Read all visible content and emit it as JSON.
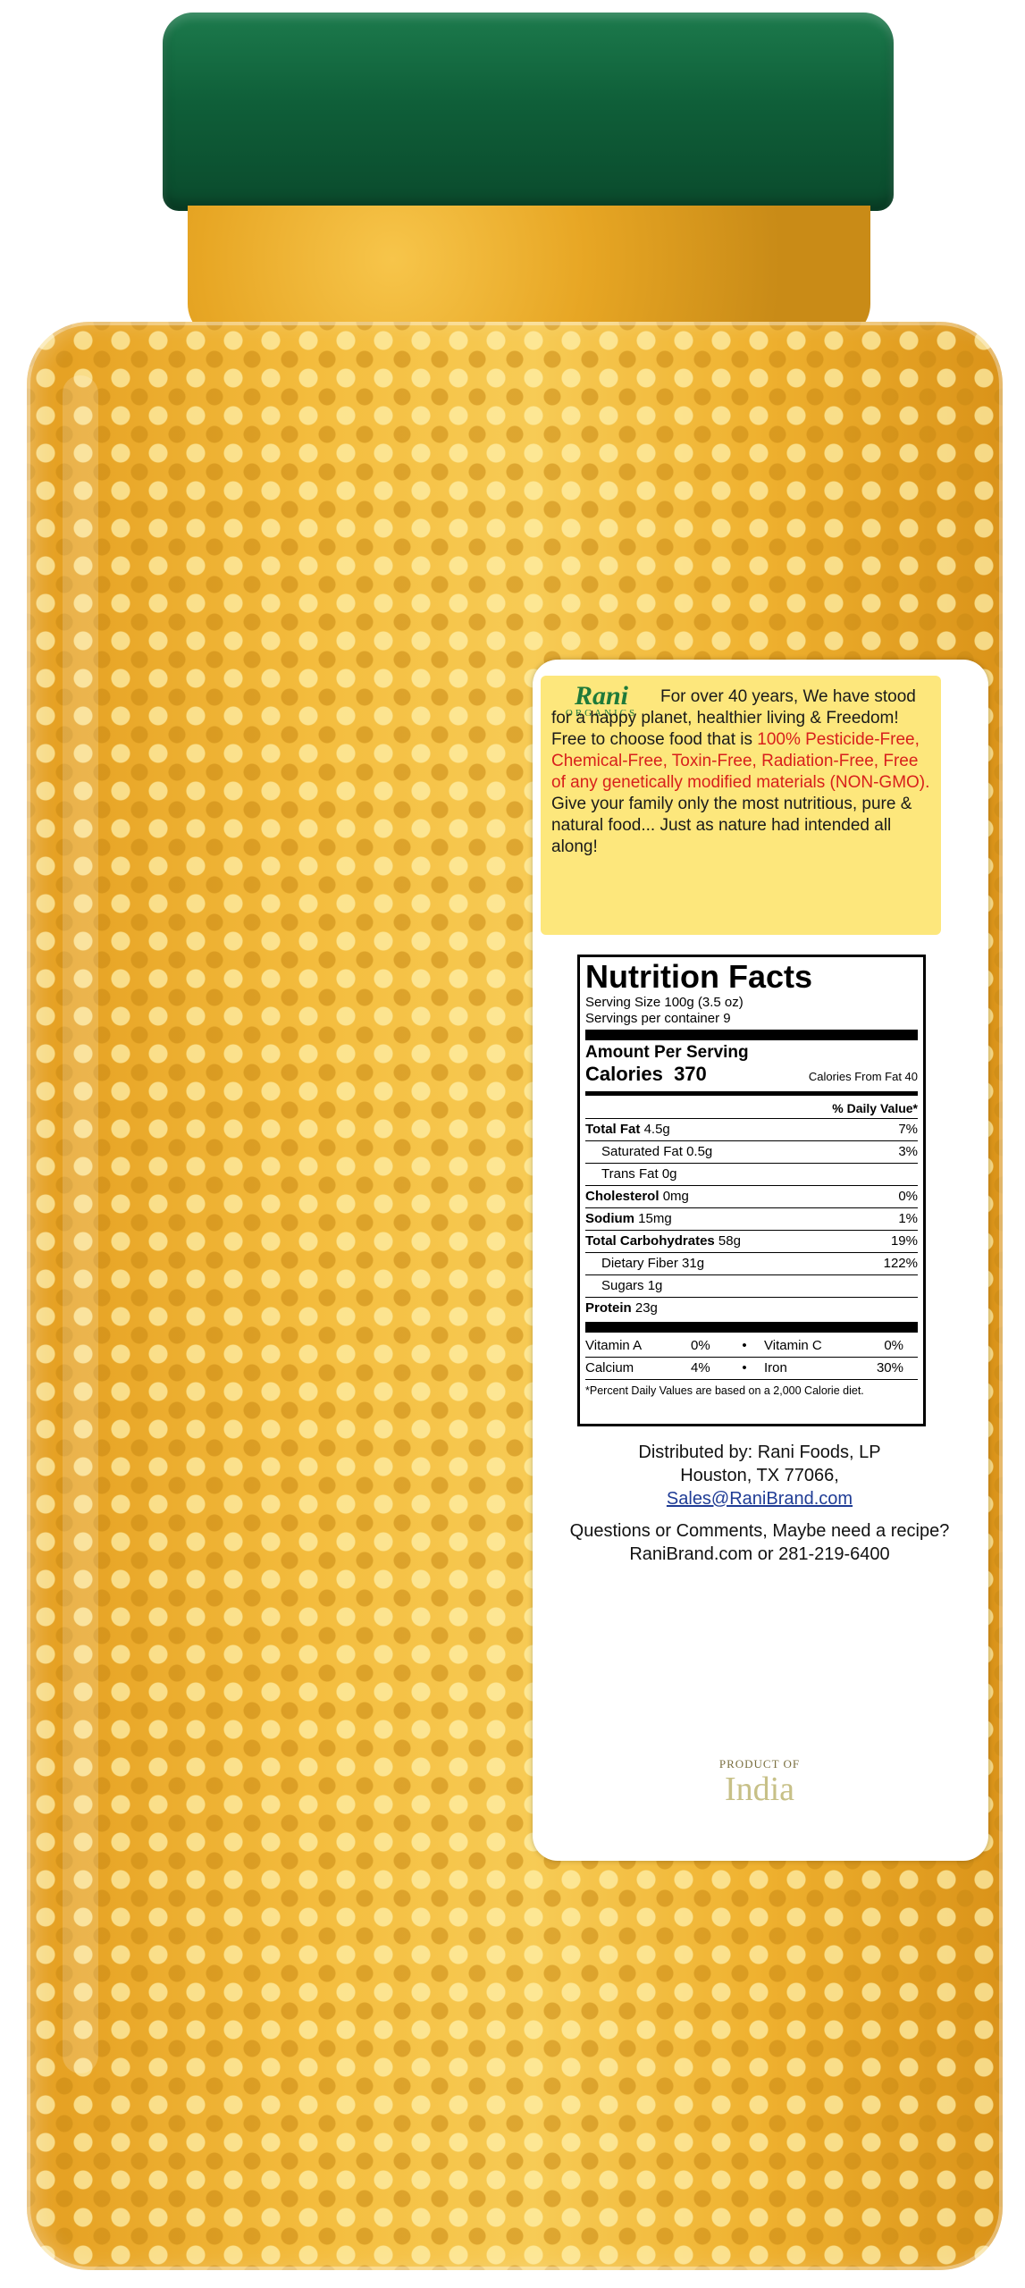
{
  "brand": {
    "name": "Rani",
    "tagline": "ORGANICS"
  },
  "promo": {
    "text_1": "For over 40 years, We have stood for a happy planet, healthier living & Freedom! Free to choose food that is ",
    "text_red": "100% Pesticide-Free, Chemical-Free, Toxin-Free, Radiation-Free, Free of any genetically modified materials (NON-GMO).",
    "text_2": " Give your family only the most nutritious, pure & natural food... Just as nature had intended all along!"
  },
  "nutrition": {
    "title": "Nutrition Facts",
    "serving_size": "Serving Size 100g (3.5 oz)",
    "servings_per_container": "Servings per container 9",
    "amount_per_serving": "Amount Per Serving",
    "calories_label": "Calories",
    "calories_value": "370",
    "calories_from_fat": "Calories From Fat 40",
    "dv_header": "% Daily Value*",
    "rows": [
      {
        "name": "Total Fat",
        "amount": "4.5g",
        "dv": "7%"
      },
      {
        "name": "Saturated Fat",
        "amount": "0.5g",
        "dv": "3%"
      },
      {
        "name": "Trans Fat",
        "amount": "0g",
        "dv": ""
      },
      {
        "name": "Cholesterol",
        "amount": "0mg",
        "dv": "0%"
      },
      {
        "name": "Sodium",
        "amount": "15mg",
        "dv": "1%"
      },
      {
        "name": "Total Carbohydrates",
        "amount": "58g",
        "dv": "19%"
      },
      {
        "name": "Dietary Fiber",
        "amount": "31g",
        "dv": "122%"
      },
      {
        "name": "Sugars",
        "amount": "1g",
        "dv": ""
      },
      {
        "name": "Protein",
        "amount": "23g",
        "dv": ""
      }
    ],
    "vitamins": [
      {
        "a_name": "Vitamin A",
        "a_val": "0%",
        "sep": "•",
        "b_name": "Vitamin C",
        "b_val": "0%"
      },
      {
        "a_name": "Calcium",
        "a_val": "4%",
        "sep": "•",
        "b_name": "Iron",
        "b_val": "30%"
      }
    ],
    "footnote": "*Percent Daily Values are based on a 2,000 Calorie diet."
  },
  "distributor": {
    "line1": "Distributed by: Rani Foods, LP",
    "line2": "Houston, TX 77066,",
    "email": "Sales@RaniBrand.com"
  },
  "contact": {
    "text": "Questions or Comments, Maybe need a recipe? RaniBrand.com or 281-219-6400"
  },
  "origin": {
    "small": "PRODUCT OF",
    "country": "India"
  }
}
